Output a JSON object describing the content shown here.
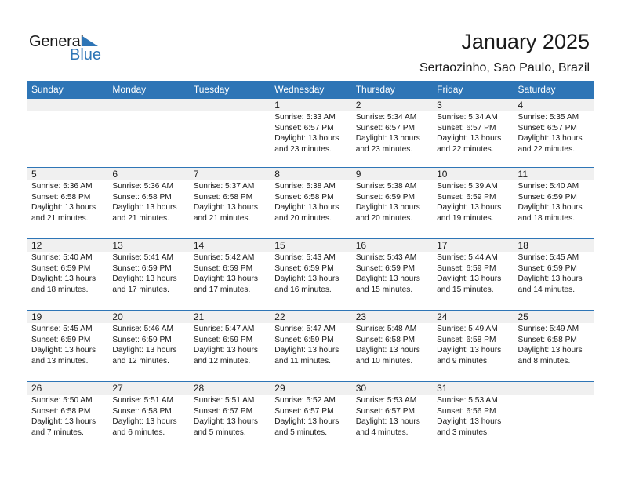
{
  "logo": {
    "general": "General",
    "blue": "Blue"
  },
  "header": {
    "title": "January 2025",
    "location": "Sertaozinho, Sao Paulo, Brazil"
  },
  "colors": {
    "accent": "#2e75b6",
    "day_number_bg": "#f0f0f0"
  },
  "weekdays": [
    "Sunday",
    "Monday",
    "Tuesday",
    "Wednesday",
    "Thursday",
    "Friday",
    "Saturday"
  ],
  "weeks": [
    [
      {
        "day": "",
        "sunrise": "",
        "sunset": "",
        "daylight": "",
        "minutes": ""
      },
      {
        "day": "",
        "sunrise": "",
        "sunset": "",
        "daylight": "",
        "minutes": ""
      },
      {
        "day": "",
        "sunrise": "",
        "sunset": "",
        "daylight": "",
        "minutes": ""
      },
      {
        "day": "1",
        "sunrise": "Sunrise: 5:33 AM",
        "sunset": "Sunset: 6:57 PM",
        "daylight": "Daylight: 13 hours",
        "minutes": "and 23 minutes."
      },
      {
        "day": "2",
        "sunrise": "Sunrise: 5:34 AM",
        "sunset": "Sunset: 6:57 PM",
        "daylight": "Daylight: 13 hours",
        "minutes": "and 23 minutes."
      },
      {
        "day": "3",
        "sunrise": "Sunrise: 5:34 AM",
        "sunset": "Sunset: 6:57 PM",
        "daylight": "Daylight: 13 hours",
        "minutes": "and 22 minutes."
      },
      {
        "day": "4",
        "sunrise": "Sunrise: 5:35 AM",
        "sunset": "Sunset: 6:57 PM",
        "daylight": "Daylight: 13 hours",
        "minutes": "and 22 minutes."
      }
    ],
    [
      {
        "day": "5",
        "sunrise": "Sunrise: 5:36 AM",
        "sunset": "Sunset: 6:58 PM",
        "daylight": "Daylight: 13 hours",
        "minutes": "and 21 minutes."
      },
      {
        "day": "6",
        "sunrise": "Sunrise: 5:36 AM",
        "sunset": "Sunset: 6:58 PM",
        "daylight": "Daylight: 13 hours",
        "minutes": "and 21 minutes."
      },
      {
        "day": "7",
        "sunrise": "Sunrise: 5:37 AM",
        "sunset": "Sunset: 6:58 PM",
        "daylight": "Daylight: 13 hours",
        "minutes": "and 21 minutes."
      },
      {
        "day": "8",
        "sunrise": "Sunrise: 5:38 AM",
        "sunset": "Sunset: 6:58 PM",
        "daylight": "Daylight: 13 hours",
        "minutes": "and 20 minutes."
      },
      {
        "day": "9",
        "sunrise": "Sunrise: 5:38 AM",
        "sunset": "Sunset: 6:59 PM",
        "daylight": "Daylight: 13 hours",
        "minutes": "and 20 minutes."
      },
      {
        "day": "10",
        "sunrise": "Sunrise: 5:39 AM",
        "sunset": "Sunset: 6:59 PM",
        "daylight": "Daylight: 13 hours",
        "minutes": "and 19 minutes."
      },
      {
        "day": "11",
        "sunrise": "Sunrise: 5:40 AM",
        "sunset": "Sunset: 6:59 PM",
        "daylight": "Daylight: 13 hours",
        "minutes": "and 18 minutes."
      }
    ],
    [
      {
        "day": "12",
        "sunrise": "Sunrise: 5:40 AM",
        "sunset": "Sunset: 6:59 PM",
        "daylight": "Daylight: 13 hours",
        "minutes": "and 18 minutes."
      },
      {
        "day": "13",
        "sunrise": "Sunrise: 5:41 AM",
        "sunset": "Sunset: 6:59 PM",
        "daylight": "Daylight: 13 hours",
        "minutes": "and 17 minutes."
      },
      {
        "day": "14",
        "sunrise": "Sunrise: 5:42 AM",
        "sunset": "Sunset: 6:59 PM",
        "daylight": "Daylight: 13 hours",
        "minutes": "and 17 minutes."
      },
      {
        "day": "15",
        "sunrise": "Sunrise: 5:43 AM",
        "sunset": "Sunset: 6:59 PM",
        "daylight": "Daylight: 13 hours",
        "minutes": "and 16 minutes."
      },
      {
        "day": "16",
        "sunrise": "Sunrise: 5:43 AM",
        "sunset": "Sunset: 6:59 PM",
        "daylight": "Daylight: 13 hours",
        "minutes": "and 15 minutes."
      },
      {
        "day": "17",
        "sunrise": "Sunrise: 5:44 AM",
        "sunset": "Sunset: 6:59 PM",
        "daylight": "Daylight: 13 hours",
        "minutes": "and 15 minutes."
      },
      {
        "day": "18",
        "sunrise": "Sunrise: 5:45 AM",
        "sunset": "Sunset: 6:59 PM",
        "daylight": "Daylight: 13 hours",
        "minutes": "and 14 minutes."
      }
    ],
    [
      {
        "day": "19",
        "sunrise": "Sunrise: 5:45 AM",
        "sunset": "Sunset: 6:59 PM",
        "daylight": "Daylight: 13 hours",
        "minutes": "and 13 minutes."
      },
      {
        "day": "20",
        "sunrise": "Sunrise: 5:46 AM",
        "sunset": "Sunset: 6:59 PM",
        "daylight": "Daylight: 13 hours",
        "minutes": "and 12 minutes."
      },
      {
        "day": "21",
        "sunrise": "Sunrise: 5:47 AM",
        "sunset": "Sunset: 6:59 PM",
        "daylight": "Daylight: 13 hours",
        "minutes": "and 12 minutes."
      },
      {
        "day": "22",
        "sunrise": "Sunrise: 5:47 AM",
        "sunset": "Sunset: 6:59 PM",
        "daylight": "Daylight: 13 hours",
        "minutes": "and 11 minutes."
      },
      {
        "day": "23",
        "sunrise": "Sunrise: 5:48 AM",
        "sunset": "Sunset: 6:58 PM",
        "daylight": "Daylight: 13 hours",
        "minutes": "and 10 minutes."
      },
      {
        "day": "24",
        "sunrise": "Sunrise: 5:49 AM",
        "sunset": "Sunset: 6:58 PM",
        "daylight": "Daylight: 13 hours",
        "minutes": "and 9 minutes."
      },
      {
        "day": "25",
        "sunrise": "Sunrise: 5:49 AM",
        "sunset": "Sunset: 6:58 PM",
        "daylight": "Daylight: 13 hours",
        "minutes": "and 8 minutes."
      }
    ],
    [
      {
        "day": "26",
        "sunrise": "Sunrise: 5:50 AM",
        "sunset": "Sunset: 6:58 PM",
        "daylight": "Daylight: 13 hours",
        "minutes": "and 7 minutes."
      },
      {
        "day": "27",
        "sunrise": "Sunrise: 5:51 AM",
        "sunset": "Sunset: 6:58 PM",
        "daylight": "Daylight: 13 hours",
        "minutes": "and 6 minutes."
      },
      {
        "day": "28",
        "sunrise": "Sunrise: 5:51 AM",
        "sunset": "Sunset: 6:57 PM",
        "daylight": "Daylight: 13 hours",
        "minutes": "and 5 minutes."
      },
      {
        "day": "29",
        "sunrise": "Sunrise: 5:52 AM",
        "sunset": "Sunset: 6:57 PM",
        "daylight": "Daylight: 13 hours",
        "minutes": "and 5 minutes."
      },
      {
        "day": "30",
        "sunrise": "Sunrise: 5:53 AM",
        "sunset": "Sunset: 6:57 PM",
        "daylight": "Daylight: 13 hours",
        "minutes": "and 4 minutes."
      },
      {
        "day": "31",
        "sunrise": "Sunrise: 5:53 AM",
        "sunset": "Sunset: 6:56 PM",
        "daylight": "Daylight: 13 hours",
        "minutes": "and 3 minutes."
      },
      {
        "day": "",
        "sunrise": "",
        "sunset": "",
        "daylight": "",
        "minutes": ""
      }
    ]
  ]
}
